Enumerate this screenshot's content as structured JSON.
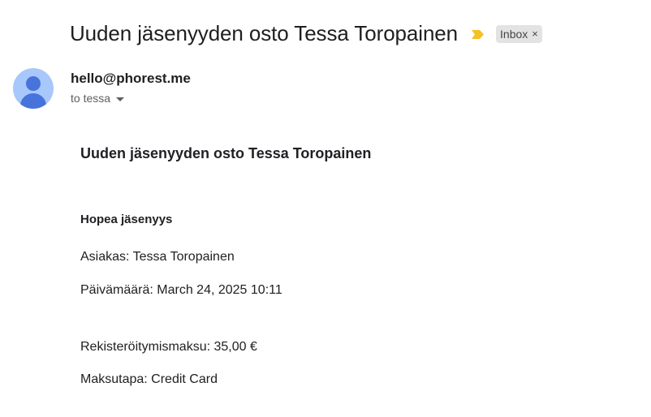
{
  "email": {
    "subject": "Uuden jäsenyyden osto Tessa Toropainen",
    "label": "Inbox",
    "label_remove": "×",
    "sender": "hello@phorest.me",
    "recipient": "to tessa"
  },
  "body": {
    "heading": "Uuden jäsenyyden osto Tessa Toropainen",
    "product": "Hopea jäsenyys",
    "customer": "Asiakas: Tessa Toropainen",
    "date": "Päivämäärä: March 24, 2025 10:11",
    "fee": "Rekisteröitymismaksu: 35,00 €",
    "payment": "Maksutapa: Credit Card"
  },
  "colors": {
    "importance": "#f6c026",
    "avatar_bg": "#a8c7fa",
    "avatar_fg": "#4773dc",
    "chip_bg": "#e3e3e3"
  },
  "icons": {
    "importance": "importance-marker-icon",
    "avatar": "person-icon",
    "recipient_details": "chevron-down-icon"
  }
}
